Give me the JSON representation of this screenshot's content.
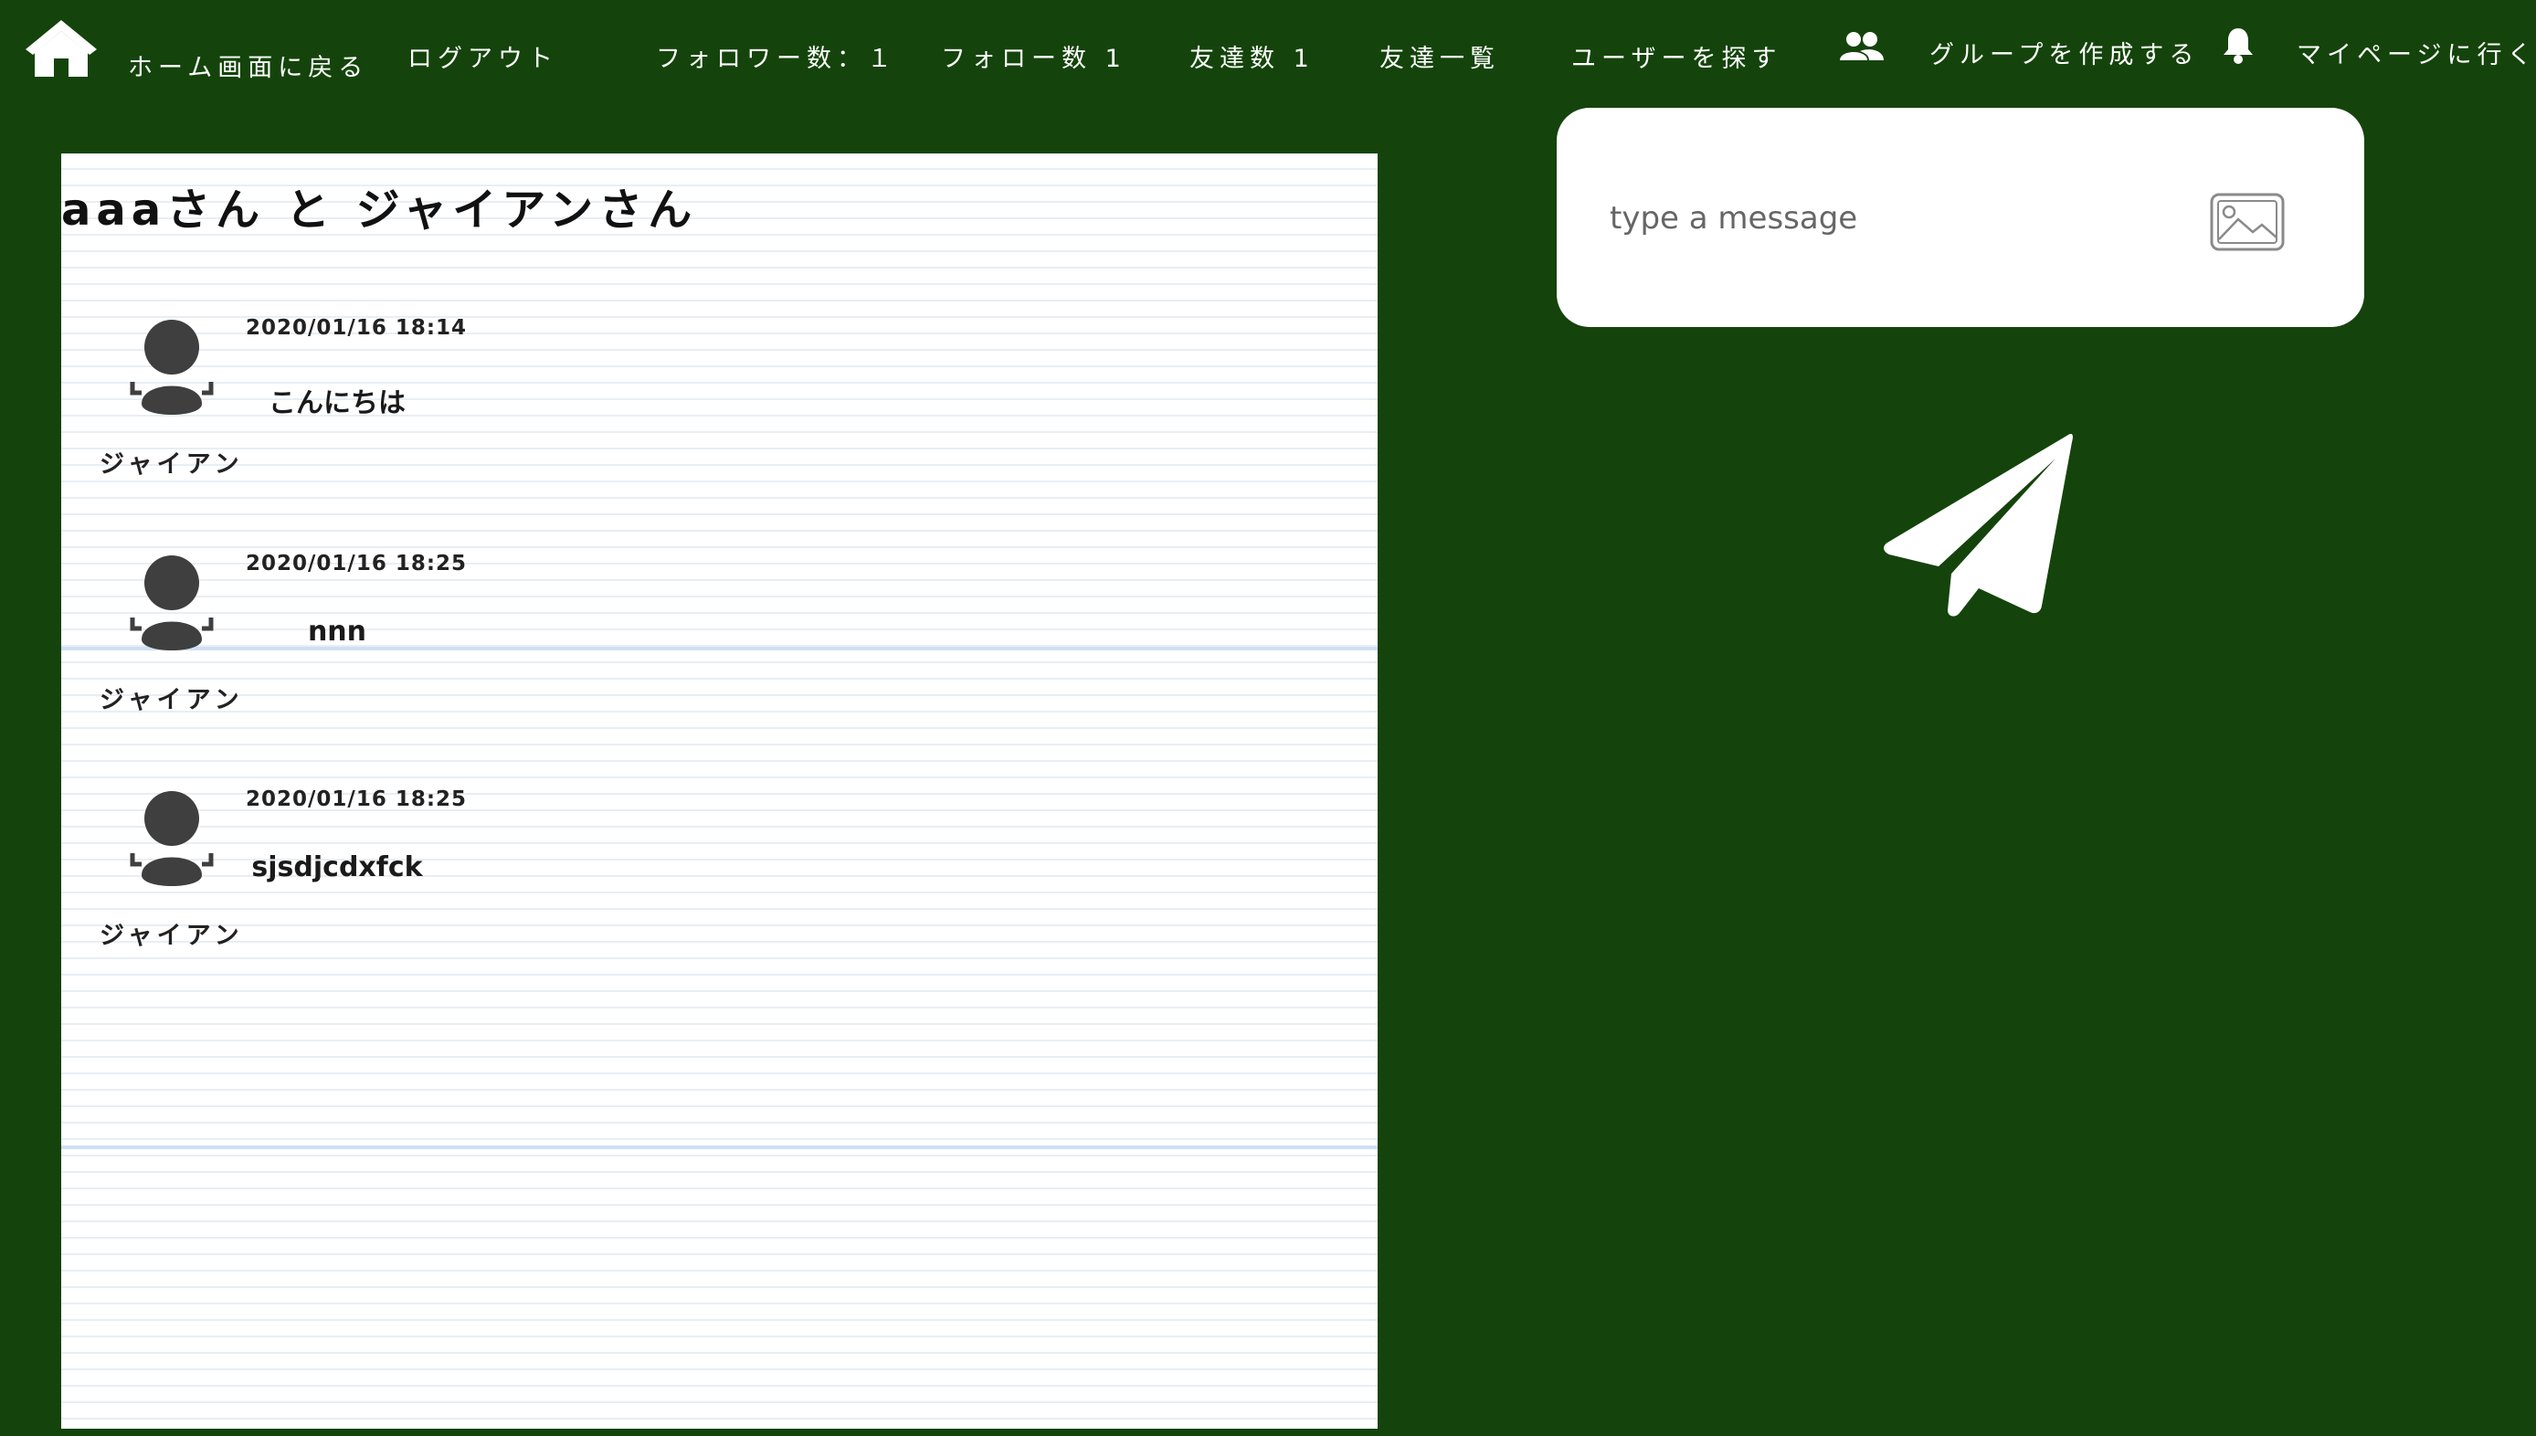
{
  "colors": {
    "background": "#14440b",
    "panel": "#ffffff",
    "nav_text": "#ffffff"
  },
  "nav": {
    "home_icon": "home-icon",
    "items": [
      {
        "label": "ホーム画面に戻る"
      },
      {
        "label": "ログアウト"
      },
      {
        "label": "フォロワー数：１"
      },
      {
        "label": "フォロー数 1"
      },
      {
        "label": "友達数 1"
      },
      {
        "label": "友達一覧"
      },
      {
        "label": "ユーザーを探す"
      },
      {
        "label": "グループを作成する",
        "icon": "group-icon"
      },
      {
        "label": "マイページに行く",
        "icon": "bell-icon"
      }
    ]
  },
  "chat": {
    "title": "aaaさん と ジャイアンさん",
    "messages": [
      {
        "sender": "ジャイアン",
        "timestamp": "2020/01/16 18:14",
        "text": "こんにちは",
        "avatar": "user-avatar-icon"
      },
      {
        "sender": "ジャイアン",
        "timestamp": "2020/01/16 18:25",
        "text": "nnn",
        "avatar": "user-avatar-icon"
      },
      {
        "sender": "ジャイアン",
        "timestamp": "2020/01/16 18:25",
        "text": "sjsdjcdxfck",
        "avatar": "user-avatar-icon"
      }
    ]
  },
  "composer": {
    "placeholder": "type a message",
    "value": "",
    "image_icon": "image-icon",
    "send_icon": "send-icon"
  }
}
